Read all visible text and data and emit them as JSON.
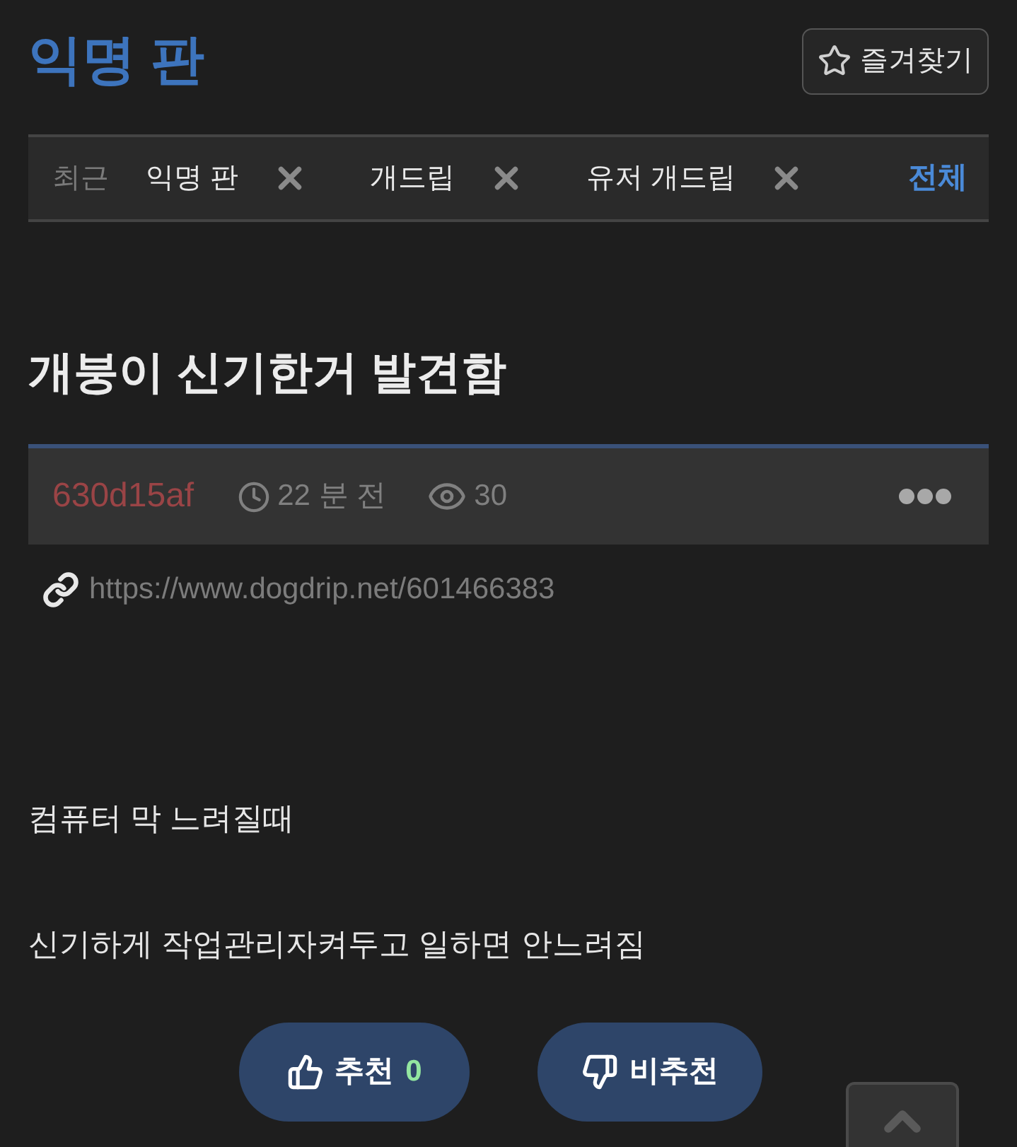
{
  "board": {
    "title": "익명 판",
    "bookmark_button": "즐겨찾기"
  },
  "recent": {
    "label": "최근",
    "items": [
      {
        "label": "익명 판"
      },
      {
        "label": "개드립"
      },
      {
        "label": "유저 개드립"
      }
    ],
    "all_link": "전체"
  },
  "post": {
    "title": "개붕이 신기한거 발견함",
    "author": "630d15af",
    "time": "22 분 전",
    "views": "30",
    "url": "https://www.dogdrip.net/601466383",
    "body": [
      "컴퓨터 막 느려질때",
      "신기하게 작업관리자켜두고 일하면 안느려짐"
    ]
  },
  "votes": {
    "upvote": {
      "label": "추천",
      "count": "0"
    },
    "downvote": {
      "label": "비추천"
    }
  }
}
